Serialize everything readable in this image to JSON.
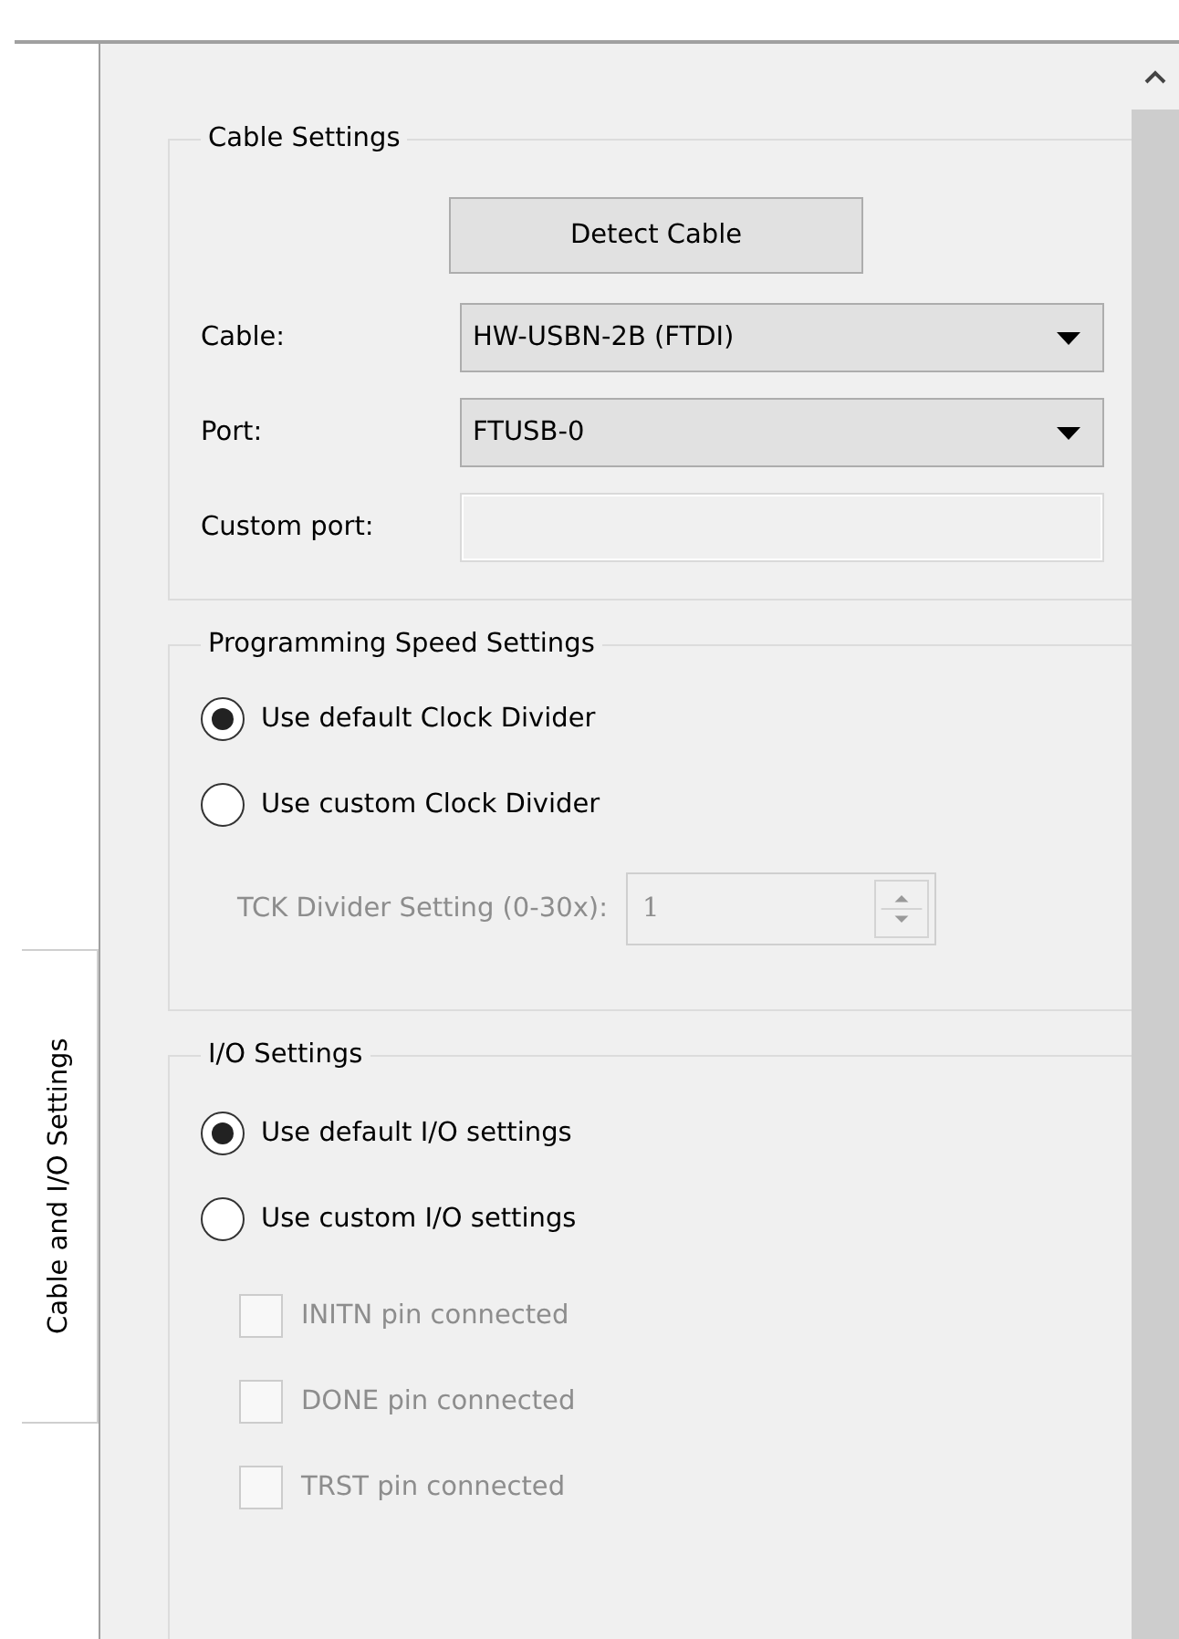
{
  "side_tab": {
    "label": "Cable and I/O Settings",
    "selected": true
  },
  "groups": [
    {
      "title": "Cable Settings",
      "kind": "cable",
      "button": "Detect Cable",
      "fields": [
        {
          "kind": "combo",
          "label": "Cable:",
          "value": "HW-USBN-2B (FTDI)"
        },
        {
          "kind": "combo",
          "label": "Port:",
          "value": "FTUSB-0"
        },
        {
          "kind": "text",
          "label": "Custom port:",
          "disabled": true
        }
      ]
    },
    {
      "title": "Programming Speed Settings",
      "kind": "options",
      "options": [
        {
          "label": "Use default Clock Divider",
          "selected": true
        },
        {
          "label": "Use custom Clock Divider",
          "selected": false
        }
      ],
      "spin": {
        "label": "TCK Divider Setting (0-30x):",
        "value": "1",
        "disabled": true
      }
    },
    {
      "title": "I/O Settings",
      "kind": "options",
      "options": [
        {
          "label": "Use default I/O settings",
          "selected": true
        },
        {
          "label": "Use custom I/O settings",
          "selected": false
        }
      ],
      "checks": [
        {
          "label": "INITN pin connected",
          "checked": false,
          "disabled": true
        },
        {
          "label": "DONE pin connected",
          "checked": false,
          "disabled": true
        },
        {
          "label": "TRST pin connected",
          "checked": false,
          "disabled": true
        }
      ]
    }
  ]
}
